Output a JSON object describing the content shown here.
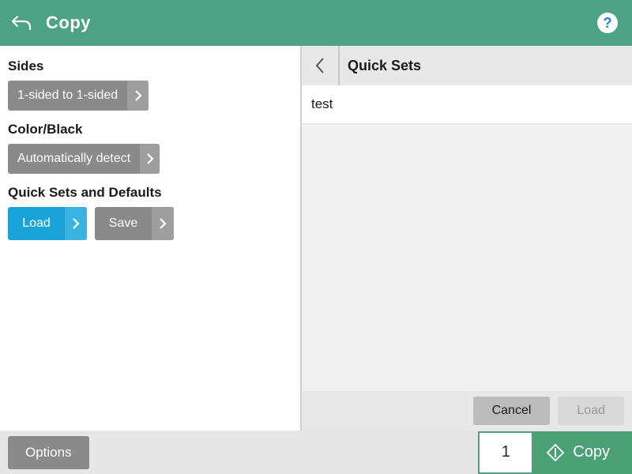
{
  "header": {
    "title": "Copy"
  },
  "sides": {
    "label": "Sides",
    "value": "1-sided to 1-sided"
  },
  "colorBlack": {
    "label": "Color/Black",
    "value": "Automatically detect"
  },
  "quickSetsDefaults": {
    "label": "Quick Sets and Defaults",
    "load": "Load",
    "save": "Save"
  },
  "rightPanel": {
    "title": "Quick Sets",
    "items": [
      "test"
    ],
    "cancel": "Cancel",
    "loadBtn": "Load"
  },
  "bottomBar": {
    "options": "Options",
    "copies": "1",
    "copyBtn": "Copy"
  }
}
